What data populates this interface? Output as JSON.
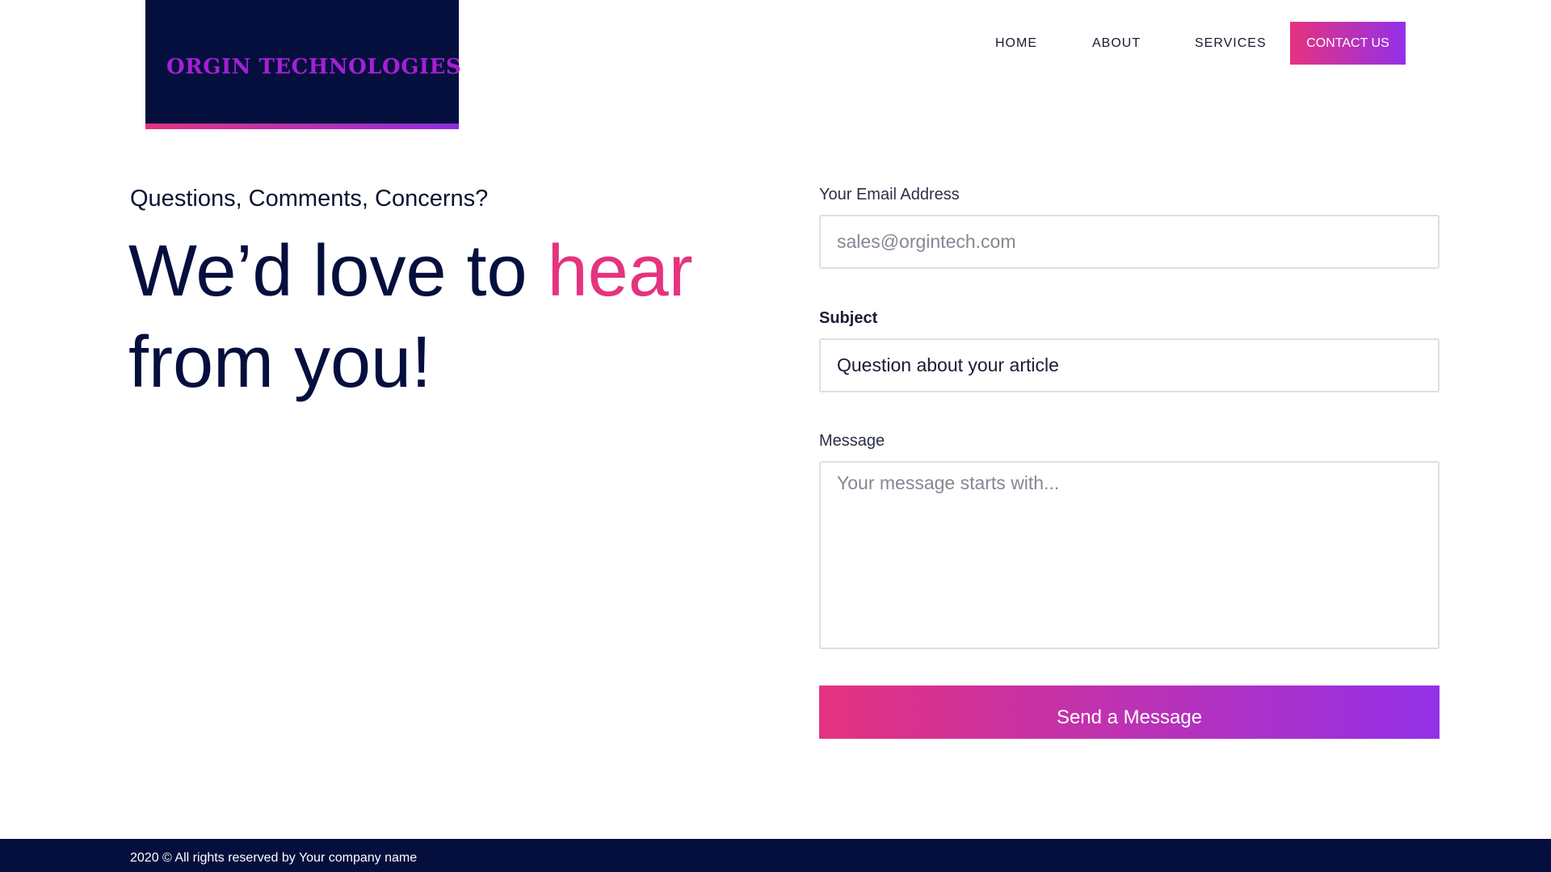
{
  "brand": {
    "logo_text": "ORGIN TECHNOLOGIES"
  },
  "nav": {
    "items": [
      {
        "label": "HOME"
      },
      {
        "label": "ABOUT"
      },
      {
        "label": "SERVICES"
      },
      {
        "label": "CONTACT US",
        "active": true
      }
    ]
  },
  "hero": {
    "eyebrow": "Questions, Comments, Concerns?",
    "headline_part1": "We’d love to ",
    "headline_accent": "hear",
    "headline_part2": "from you!"
  },
  "form": {
    "email": {
      "label": "Your Email Address",
      "placeholder": "sales@orgintech.com",
      "value": ""
    },
    "subject": {
      "label": "Subject",
      "placeholder": "",
      "value": "Question about your article"
    },
    "message": {
      "label": "Message",
      "placeholder": "Your message starts with...",
      "value": ""
    },
    "submit_label": "Send a Message"
  },
  "footer": {
    "text": "2020 © All rights reserved by Your company name"
  },
  "colors": {
    "navy": "#050f3e",
    "accent_pink": "#e5337f",
    "accent_purple": "#9330e8",
    "logo_text": "#a51fd6"
  }
}
